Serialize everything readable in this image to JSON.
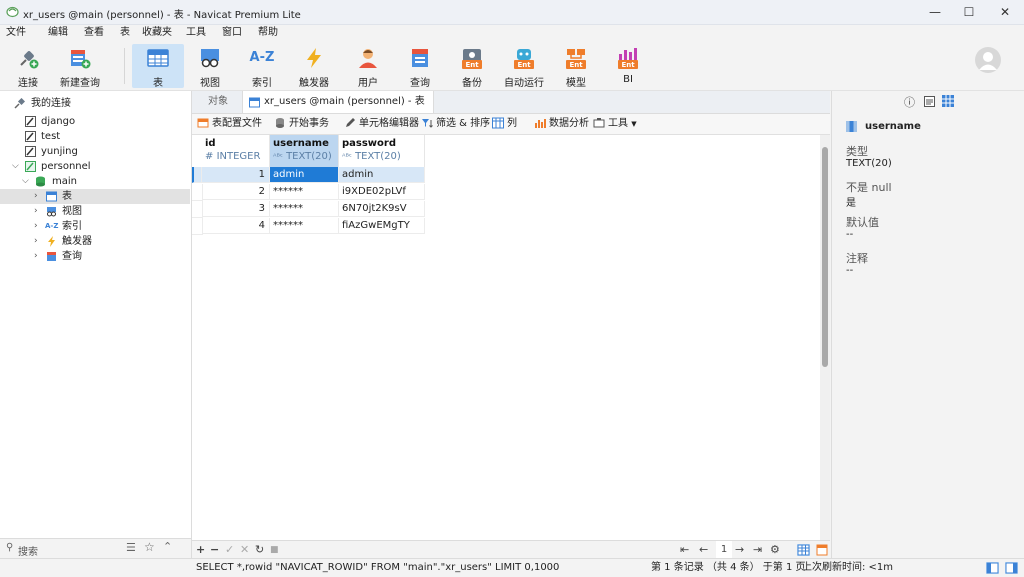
{
  "window": {
    "title": "xr_users @main (personnel) - 表 - Navicat Premium Lite",
    "minimize": "—",
    "maximize": "☐",
    "close": "✕"
  },
  "menu": [
    "文件",
    "编辑",
    "查看",
    "表",
    "收藏夹",
    "工具",
    "窗口",
    "帮助"
  ],
  "toolbar": {
    "connect": "连接",
    "new_query": "新建查询",
    "table": "表",
    "view": "视图",
    "index": "索引",
    "trigger": "触发器",
    "user": "用户",
    "query": "查询",
    "backup": "备份",
    "automation": "自动运行",
    "model": "模型",
    "bi": "BI",
    "index_icon_text": "A-Z",
    "ent": "Ent"
  },
  "sidebar": {
    "header": "我的连接",
    "connections": [
      "django",
      "test",
      "yunjing",
      "personnel"
    ],
    "schema": "main",
    "objects": [
      "表",
      "视图",
      "索引",
      "触发器",
      "查询"
    ],
    "index_glyph": "A-Z",
    "search_placeholder": "搜索"
  },
  "tabs": {
    "objects": "对象",
    "active": "xr_users @main (personnel) - 表"
  },
  "grid_toolbar": {
    "table_config": "表配置文件",
    "begin_tx": "开始事务",
    "cell_editor": "单元格编辑器",
    "filter_sort": "筛选 & 排序",
    "columns": "列",
    "data_analysis": "数据分析",
    "tools": "工具"
  },
  "grid": {
    "columns": [
      {
        "name": "id",
        "type": "INTEGER",
        "type_icon": "#"
      },
      {
        "name": "username",
        "type": "TEXT(20)",
        "type_icon": "ᴬᴮᶜ"
      },
      {
        "name": "password",
        "type": "TEXT(20)",
        "type_icon": "ᴬᴮᶜ"
      }
    ],
    "rows": [
      [
        "1",
        "admin",
        "admin"
      ],
      [
        "2",
        "******",
        "i9XDE02pLVf"
      ],
      [
        "3",
        "******",
        "6N70jt2K9sV"
      ],
      [
        "4",
        "******",
        "fiAzGwEMgTY"
      ]
    ]
  },
  "grid_bottom": {
    "add": "+",
    "remove": "−",
    "apply": "✓",
    "discard": "✕",
    "refresh": "↻",
    "stop": "■",
    "first": "⇤",
    "prev": "←",
    "page": "1",
    "next": "→",
    "last": "⇥",
    "settings": "⚙"
  },
  "right_panel": {
    "field": "username",
    "type_label": "类型",
    "type_value": "TEXT(20)",
    "notnull_label": "不是 null",
    "notnull_value": "是",
    "default_label": "默认值",
    "default_value": "--",
    "comment_label": "注释",
    "comment_value": "--"
  },
  "status": {
    "sql": "SELECT *,rowid \"NAVICAT_ROWID\" FROM \"main\".\"xr_users\" LIMIT 0,1000",
    "records": "第 1 条记录 （共 4 条） 于第 1 页",
    "refresh": "上次刷新时间: <1m"
  },
  "colors": {
    "accent": "#1f7bd6",
    "selection": "#cde3f7",
    "header_selected": "#bcd6f0"
  }
}
